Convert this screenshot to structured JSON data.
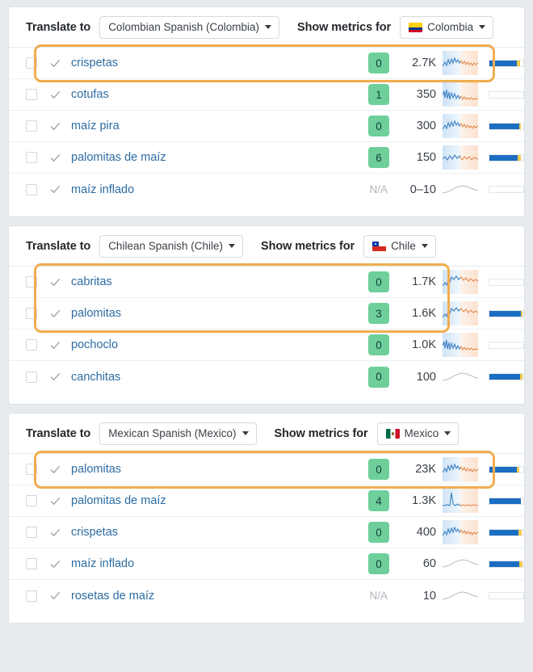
{
  "sections": [
    {
      "translate_label": "Translate to",
      "language": "Colombian Spanish (Colombia)",
      "metrics_label": "Show metrics for",
      "country": "Colombia",
      "flag": "flag-co",
      "rows": [
        {
          "keyword": "crispetas",
          "kd": "0",
          "volume": "2.7K",
          "bar_blue": 82,
          "bar_yellow": 8,
          "trend": "noisy-down",
          "highlighted": true
        },
        {
          "keyword": "cotufas",
          "kd": "1",
          "volume": "350",
          "bar_blue": 0,
          "bar_yellow": 0,
          "trend": "spiky",
          "highlighted": false
        },
        {
          "keyword": "maíz pira",
          "kd": "0",
          "volume": "300",
          "bar_blue": 88,
          "bar_yellow": 6,
          "trend": "noisy-down",
          "highlighted": false
        },
        {
          "keyword": "palomitas de maíz",
          "kd": "6",
          "volume": "150",
          "bar_blue": 84,
          "bar_yellow": 9,
          "trend": "wavy",
          "highlighted": false
        },
        {
          "keyword": "maíz inflado",
          "kd": "N/A",
          "volume": "0–10",
          "bar_blue": 0,
          "bar_yellow": 0,
          "trend": "flat",
          "highlighted": false
        }
      ]
    },
    {
      "translate_label": "Translate to",
      "language": "Chilean Spanish (Chile)",
      "metrics_label": "Show metrics for",
      "country": "Chile",
      "flag": "flag-cl",
      "rows": [
        {
          "keyword": "cabritas",
          "kd": "0",
          "volume": "1.7K",
          "bar_blue": 0,
          "bar_yellow": 0,
          "trend": "hump",
          "highlighted": true
        },
        {
          "keyword": "palomitas",
          "kd": "3",
          "volume": "1.6K",
          "bar_blue": 92,
          "bar_yellow": 6,
          "trend": "hump",
          "highlighted": true
        },
        {
          "keyword": "pochoclo",
          "kd": "0",
          "volume": "1.0K",
          "bar_blue": 0,
          "bar_yellow": 0,
          "trend": "spiky",
          "highlighted": false
        },
        {
          "keyword": "canchitas",
          "kd": "0",
          "volume": "100",
          "bar_blue": 90,
          "bar_yellow": 7,
          "trend": "flat",
          "highlighted": false
        }
      ]
    },
    {
      "translate_label": "Translate to",
      "language": "Mexican Spanish (Mexico)",
      "metrics_label": "Show metrics for",
      "country": "Mexico",
      "flag": "flag-mx",
      "rows": [
        {
          "keyword": "palomitas",
          "kd": "0",
          "volume": "23K",
          "bar_blue": 80,
          "bar_yellow": 8,
          "trend": "noisy-down",
          "highlighted": true
        },
        {
          "keyword": "palomitas de maíz",
          "kd": "4",
          "volume": "1.3K",
          "bar_blue": 94,
          "bar_yellow": 0,
          "trend": "spike1",
          "highlighted": false
        },
        {
          "keyword": "crispetas",
          "kd": "0",
          "volume": "400",
          "bar_blue": 86,
          "bar_yellow": 9,
          "trend": "noisy-down",
          "highlighted": false
        },
        {
          "keyword": "maíz inflado",
          "kd": "0",
          "volume": "60",
          "bar_blue": 88,
          "bar_yellow": 9,
          "trend": "flat",
          "highlighted": false
        },
        {
          "keyword": "rosetas de maíz",
          "kd": "N/A",
          "volume": "10",
          "bar_blue": 0,
          "bar_yellow": 0,
          "trend": "flat",
          "highlighted": false
        }
      ]
    }
  ],
  "icons": {
    "check": "check-icon",
    "caret": "chevron-down-icon"
  },
  "colors": {
    "keyword_link": "#2d6ca2",
    "kd_badge": "#6ecf9b",
    "highlight": "#f0ad4e",
    "bar_blue": "#1b6ec2",
    "bar_yellow": "#f2c94c"
  }
}
